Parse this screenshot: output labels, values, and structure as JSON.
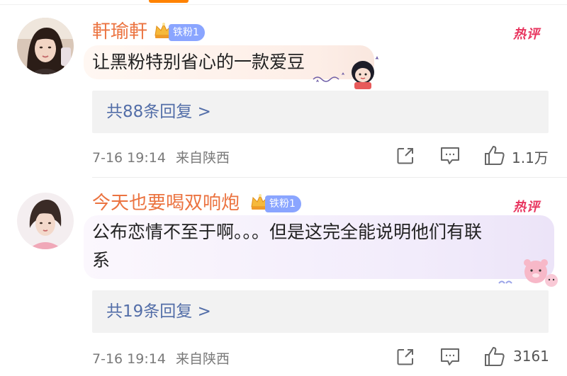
{
  "comments": [
    {
      "username": "軒瑜軒",
      "fan_badge": "铁粉1",
      "hot_tag": "热评",
      "text_line1": "让黑粉特别省心的一款爱豆",
      "text_line2": "",
      "replies_link": "共88条回复 >",
      "timestamp": "7-16 19:14",
      "location": "来自陕西",
      "likes": "1.1万"
    },
    {
      "username": "今天也要喝双响炮",
      "fan_badge": "铁粉1",
      "hot_tag": "热评",
      "text_line1": "公布恋情不至于啊。。。但是这完全能说明他们有联",
      "text_line2": "系",
      "replies_link": "共19条回复 >",
      "timestamp": "7-16 19:14",
      "location": "来自陕西",
      "likes": "3161"
    }
  ],
  "icons": {
    "share": "share-icon",
    "comment": "comment-icon",
    "like": "like-icon",
    "crown": "crown-icon"
  },
  "colors": {
    "username": "#eb7340",
    "fan_badge": "#8aa5ff",
    "hot_tag": "#e8355f",
    "reply_link": "#536ea8",
    "reply_box": "#f2f2f2",
    "meta": "#7a7a7a"
  }
}
